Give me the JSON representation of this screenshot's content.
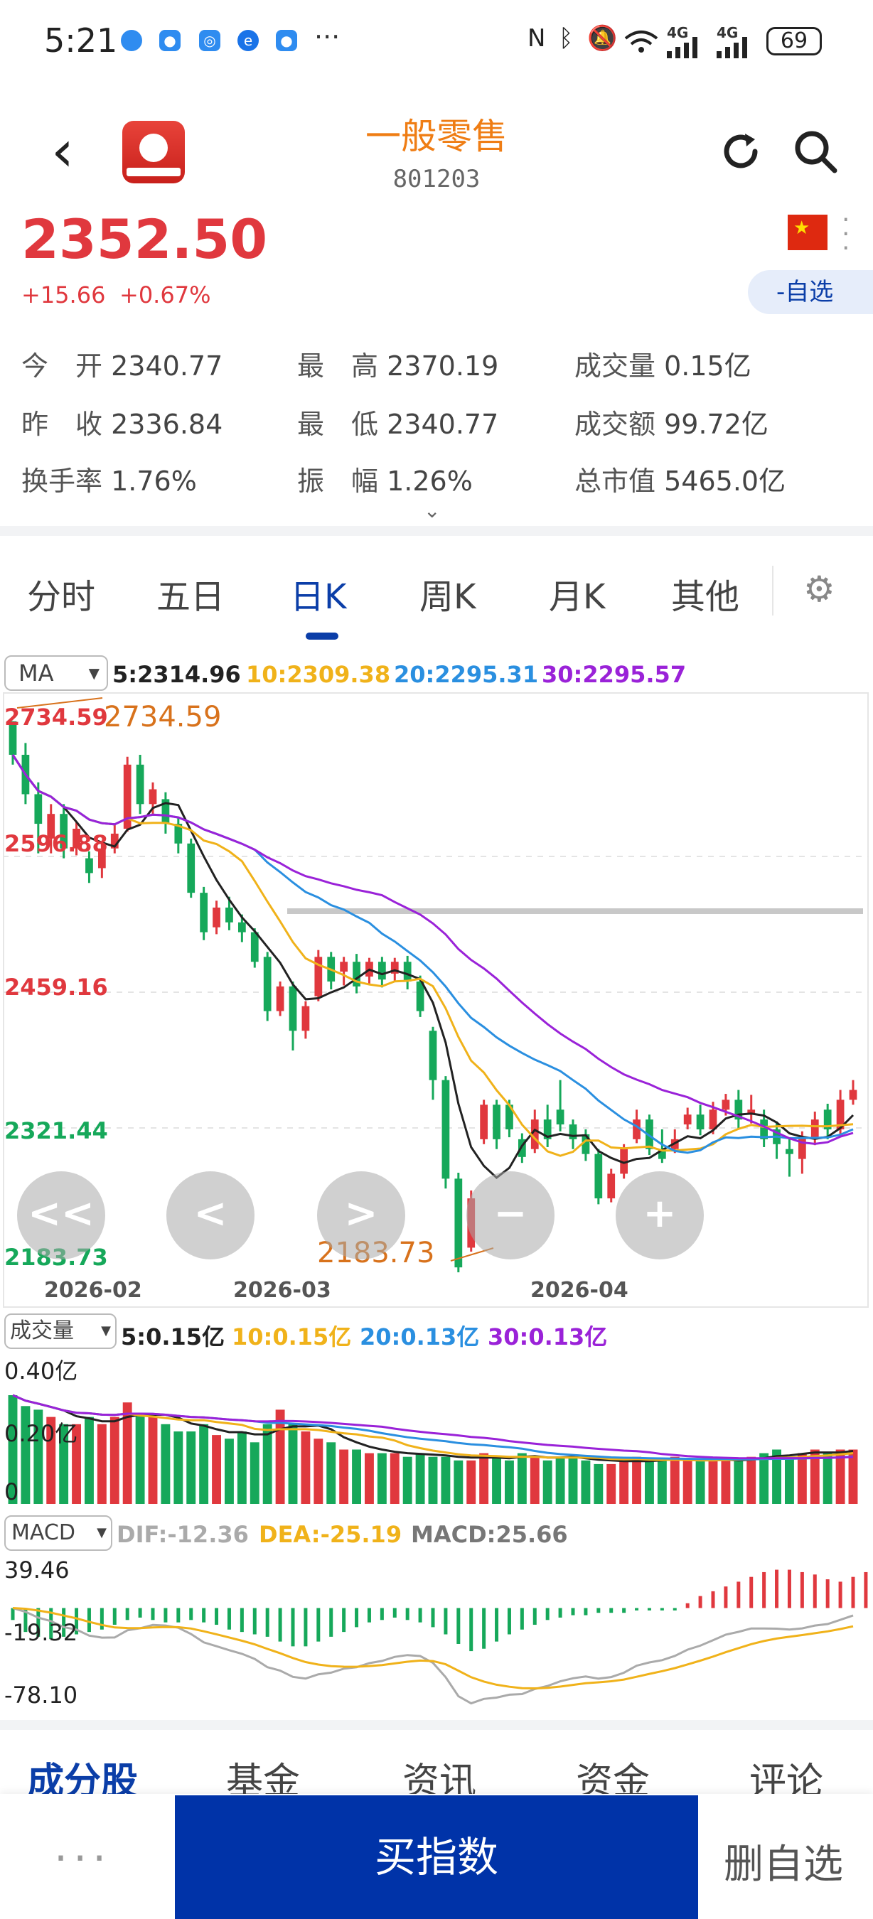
{
  "status_bar": {
    "time": "5:21",
    "dots": "···",
    "battery": "69",
    "network_4g_1": "4G",
    "network_4g_2": "4G"
  },
  "header": {
    "title": "一般零售",
    "code": "801203"
  },
  "quote": {
    "price": "2352.50",
    "change": "+15.66",
    "change_pct": "+0.67%",
    "watchlist_label": "-自选"
  },
  "stats": [
    {
      "label": "今　开",
      "value": "2340.77"
    },
    {
      "label": "最　高",
      "value": "2370.19"
    },
    {
      "label": "成交量",
      "value": "0.15亿"
    },
    {
      "label": "昨　收",
      "value": "2336.84"
    },
    {
      "label": "最　低",
      "value": "2340.77"
    },
    {
      "label": "成交额",
      "value": "99.72亿"
    },
    {
      "label": "换手率",
      "value": "1.76%"
    },
    {
      "label": "振　幅",
      "value": "1.26%"
    },
    {
      "label": "总市值",
      "value": "5465.0亿"
    }
  ],
  "tabs": [
    "分时",
    "五日",
    "日K",
    "周K",
    "月K",
    "其他"
  ],
  "active_tab": "日K",
  "ma_legend": {
    "selector": "MA",
    "ma5": "5:2314.96",
    "ma10": "10:2309.38",
    "ma20": "20:2295.31",
    "ma30": "30:2295.57"
  },
  "colors": {
    "up": "#e0383e",
    "down": "#16a85a",
    "ma5": "#222222",
    "ma10": "#f0b21a",
    "ma20": "#2a8fe0",
    "ma30": "#9a22d8",
    "accent": "#0b3ea8",
    "title": "#ef7d14"
  },
  "price_axis": {
    "labels": [
      "2734.59",
      "2596.88",
      "2459.16",
      "2321.44",
      "2183.73"
    ],
    "high_annotation": "2734.59",
    "low_annotation": "2183.73"
  },
  "date_axis": [
    "2026-02",
    "2026-03",
    "2026-04"
  ],
  "volume_legend": {
    "selector": "成交量",
    "v5": "5:0.15亿",
    "v10": "10:0.15亿",
    "v20": "20:0.13亿",
    "v30": "30:0.13亿"
  },
  "volume_axis": [
    "0.40亿",
    "0.20亿",
    "0"
  ],
  "macd_legend": {
    "selector": "MACD",
    "dif": "DIF:-12.36",
    "dea": "DEA:-25.19",
    "macd": "MACD:25.66"
  },
  "macd_axis": [
    "39.46",
    "-19.32",
    "-78.10"
  ],
  "chart_nav": [
    "<<",
    "<",
    ">",
    "−",
    "+"
  ],
  "bottom_tabs": [
    "成分股",
    "基金",
    "资讯",
    "资金",
    "评论"
  ],
  "bottom_bar": {
    "more": "···",
    "buy": "买指数",
    "delete": "删自选"
  },
  "chart_data": {
    "type": "candlestick",
    "y_range": [
      2183.73,
      2734.59
    ],
    "candles": [
      [
        2734,
        2700,
        2734,
        2690
      ],
      [
        2700,
        2660,
        2712,
        2650
      ],
      [
        2660,
        2630,
        2672,
        2600
      ],
      [
        2615,
        2640,
        2650,
        2600
      ],
      [
        2640,
        2605,
        2650,
        2595
      ],
      [
        2605,
        2625,
        2632,
        2598
      ],
      [
        2595,
        2580,
        2602,
        2570
      ],
      [
        2585,
        2605,
        2610,
        2575
      ],
      [
        2605,
        2620,
        2630,
        2600
      ],
      [
        2625,
        2690,
        2698,
        2622
      ],
      [
        2690,
        2650,
        2700,
        2640
      ],
      [
        2650,
        2665,
        2672,
        2640
      ],
      [
        2655,
        2630,
        2662,
        2620
      ],
      [
        2630,
        2610,
        2636,
        2600
      ],
      [
        2610,
        2560,
        2615,
        2555
      ],
      [
        2560,
        2520,
        2566,
        2512
      ],
      [
        2525,
        2545,
        2552,
        2518
      ],
      [
        2545,
        2530,
        2556,
        2522
      ],
      [
        2530,
        2520,
        2538,
        2510
      ],
      [
        2520,
        2490,
        2524,
        2484
      ],
      [
        2495,
        2440,
        2500,
        2430
      ],
      [
        2440,
        2465,
        2470,
        2435
      ],
      [
        2465,
        2420,
        2470,
        2400
      ],
      [
        2420,
        2445,
        2450,
        2412
      ],
      [
        2455,
        2495,
        2502,
        2450
      ],
      [
        2495,
        2470,
        2500,
        2462
      ],
      [
        2480,
        2490,
        2495,
        2466
      ],
      [
        2490,
        2465,
        2498,
        2458
      ],
      [
        2475,
        2490,
        2494,
        2468
      ],
      [
        2490,
        2472,
        2495,
        2464
      ],
      [
        2478,
        2490,
        2494,
        2470
      ],
      [
        2490,
        2470,
        2496,
        2462
      ],
      [
        2470,
        2440,
        2476,
        2434
      ],
      [
        2420,
        2370,
        2424,
        2350
      ],
      [
        2370,
        2270,
        2374,
        2260
      ],
      [
        2270,
        2180,
        2276,
        2175
      ],
      [
        2200,
        2250,
        2258,
        2196
      ],
      [
        2310,
        2345,
        2350,
        2305
      ],
      [
        2345,
        2310,
        2350,
        2300
      ],
      [
        2345,
        2320,
        2350,
        2312
      ],
      [
        2310,
        2292,
        2316,
        2286
      ],
      [
        2300,
        2330,
        2340,
        2296
      ],
      [
        2330,
        2310,
        2345,
        2302
      ],
      [
        2340,
        2325,
        2370,
        2318
      ],
      [
        2325,
        2310,
        2330,
        2300
      ],
      [
        2315,
        2295,
        2320,
        2288
      ],
      [
        2295,
        2250,
        2300,
        2244
      ],
      [
        2250,
        2275,
        2280,
        2246
      ],
      [
        2275,
        2300,
        2305,
        2270
      ],
      [
        2310,
        2330,
        2340,
        2306
      ],
      [
        2330,
        2300,
        2335,
        2294
      ],
      [
        2300,
        2290,
        2320,
        2286
      ],
      [
        2300,
        2310,
        2320,
        2296
      ],
      [
        2325,
        2335,
        2342,
        2320
      ],
      [
        2335,
        2320,
        2345,
        2314
      ],
      [
        2320,
        2340,
        2348,
        2315
      ],
      [
        2340,
        2350,
        2356,
        2334
      ],
      [
        2350,
        2330,
        2360,
        2320
      ],
      [
        2335,
        2340,
        2355,
        2326
      ],
      [
        2330,
        2310,
        2340,
        2302
      ],
      [
        2320,
        2305,
        2328,
        2290
      ],
      [
        2300,
        2295,
        2312,
        2272
      ],
      [
        2290,
        2312,
        2318,
        2275
      ],
      [
        2310,
        2330,
        2338,
        2304
      ],
      [
        2340,
        2320,
        2346,
        2310
      ],
      [
        2320,
        2350,
        2360,
        2315
      ],
      [
        2350,
        2360,
        2370,
        2345
      ]
    ],
    "volumes": [
      0.3,
      0.27,
      0.26,
      0.24,
      0.22,
      0.22,
      0.24,
      0.22,
      0.24,
      0.28,
      0.25,
      0.24,
      0.22,
      0.2,
      0.2,
      0.22,
      0.19,
      0.18,
      0.2,
      0.17,
      0.22,
      0.26,
      0.22,
      0.2,
      0.18,
      0.17,
      0.15,
      0.15,
      0.14,
      0.14,
      0.14,
      0.13,
      0.14,
      0.13,
      0.13,
      0.12,
      0.12,
      0.14,
      0.13,
      0.12,
      0.14,
      0.13,
      0.12,
      0.13,
      0.13,
      0.12,
      0.11,
      0.11,
      0.12,
      0.13,
      0.12,
      0.12,
      0.13,
      0.12,
      0.12,
      0.12,
      0.12,
      0.12,
      0.13,
      0.14,
      0.15,
      0.13,
      0.14,
      0.15,
      0.14,
      0.15,
      0.15
    ],
    "macd_hist": [
      -10,
      -20,
      -24,
      -26,
      -24,
      -22,
      -20,
      -18,
      -14,
      -10,
      -8,
      -10,
      -12,
      -12,
      -10,
      -12,
      -14,
      -18,
      -20,
      -22,
      -24,
      -28,
      -32,
      -32,
      -28,
      -24,
      -20,
      -16,
      -12,
      -10,
      -8,
      -10,
      -12,
      -16,
      -22,
      -30,
      -36,
      -34,
      -28,
      -22,
      -18,
      -14,
      -10,
      -8,
      -6,
      -6,
      -4,
      -4,
      -4,
      -2,
      -2,
      -2,
      -2,
      4,
      10,
      14,
      18,
      22,
      26,
      30,
      32,
      32,
      30,
      28,
      24,
      22,
      26,
      30
    ],
    "macd_ylim": [
      -78.1,
      39.46
    ],
    "volume_ylim": [
      0,
      0.4
    ]
  }
}
